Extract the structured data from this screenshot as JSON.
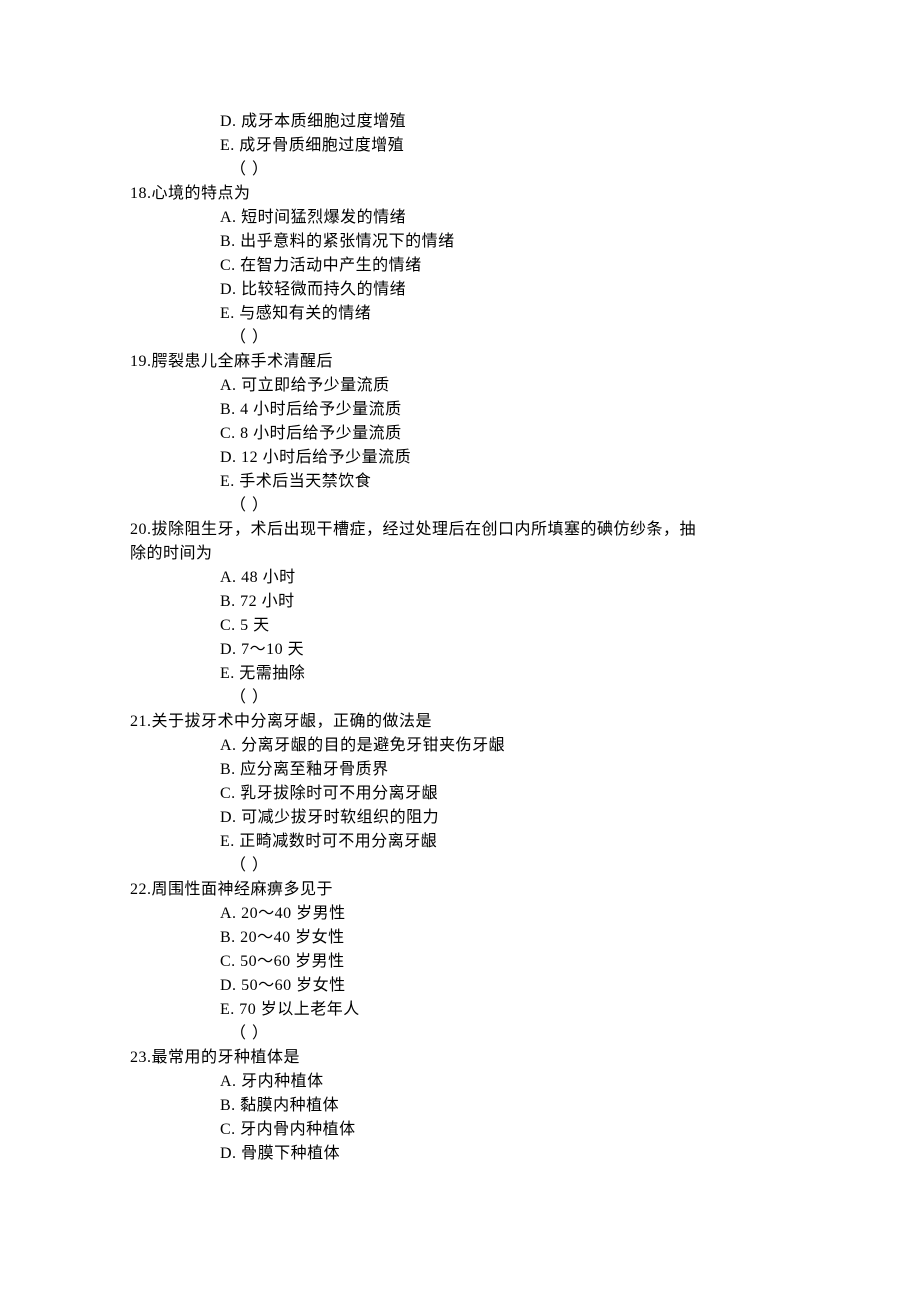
{
  "preOptions": {
    "D": {
      "letter": "D.",
      "text": "成牙本质细胞过度增殖"
    },
    "E": {
      "letter": "E.",
      "text": "成牙骨质细胞过度增殖"
    }
  },
  "blank": "（   ）",
  "questions": {
    "q18": {
      "num": "18.",
      "text": "心境的特点为",
      "opts": {
        "A": {
          "letter": "A.",
          "text": "短时间猛烈爆发的情绪"
        },
        "B": {
          "letter": "B.",
          "text": "出乎意料的紧张情况下的情绪"
        },
        "C": {
          "letter": "C.",
          "text": "在智力活动中产生的情绪"
        },
        "D": {
          "letter": "D.",
          "text": "比较轻微而持久的情绪"
        },
        "E": {
          "letter": "E.",
          "text": "与感知有关的情绪"
        }
      }
    },
    "q19": {
      "num": "19.",
      "text": "腭裂患儿全麻手术清醒后",
      "opts": {
        "A": {
          "letter": "A.",
          "text": "可立即给予少量流质"
        },
        "B": {
          "letter": "B.",
          "text": "4 小时后给予少量流质"
        },
        "C": {
          "letter": "C.",
          "text": "8 小时后给予少量流质"
        },
        "D": {
          "letter": "D.",
          "text": "12 小时后给予少量流质"
        },
        "E": {
          "letter": "E.",
          "text": "手术后当天禁饮食"
        }
      }
    },
    "q20": {
      "num": "20.",
      "text1": "拔除阻生牙，术后出现干槽症，经过处理后在创口内所填塞的碘仿纱条，抽",
      "text2": "除的时间为",
      "opts": {
        "A": {
          "letter": "A.",
          "text": "48 小时"
        },
        "B": {
          "letter": "B.",
          "text": "72 小时"
        },
        "C": {
          "letter": "C.",
          "text": "5 天"
        },
        "D": {
          "letter": "D.",
          "text": "7～10 天"
        },
        "E": {
          "letter": "E.",
          "text": "无需抽除"
        }
      }
    },
    "q21": {
      "num": "21.",
      "text": "关于拔牙术中分离牙龈，正确的做法是",
      "opts": {
        "A": {
          "letter": "A.",
          "text": "分离牙龈的目的是避免牙钳夹伤牙龈"
        },
        "B": {
          "letter": "B.",
          "text": "应分离至釉牙骨质界"
        },
        "C": {
          "letter": "C.",
          "text": "乳牙拔除时可不用分离牙龈"
        },
        "D": {
          "letter": "D.",
          "text": "可减少拔牙时软组织的阻力"
        },
        "E": {
          "letter": "E.",
          "text": "正畸减数时可不用分离牙龈"
        }
      }
    },
    "q22": {
      "num": "22.",
      "text": "周围性面神经麻痹多见于",
      "opts": {
        "A": {
          "letter": "A.",
          "text": "20～40 岁男性"
        },
        "B": {
          "letter": "B.",
          "text": "20～40 岁女性"
        },
        "C": {
          "letter": "C.",
          "text": "50～60 岁男性"
        },
        "D": {
          "letter": "D.",
          "text": "50～60 岁女性"
        },
        "E": {
          "letter": "E.",
          "text": "70 岁以上老年人"
        }
      }
    },
    "q23": {
      "num": "23.",
      "text": "最常用的牙种植体是",
      "opts": {
        "A": {
          "letter": "A.",
          "text": "牙内种植体"
        },
        "B": {
          "letter": "B.",
          "text": "黏膜内种植体"
        },
        "C": {
          "letter": "C.",
          "text": "牙内骨内种植体"
        },
        "D": {
          "letter": "D.",
          "text": "骨膜下种植体"
        }
      }
    }
  }
}
